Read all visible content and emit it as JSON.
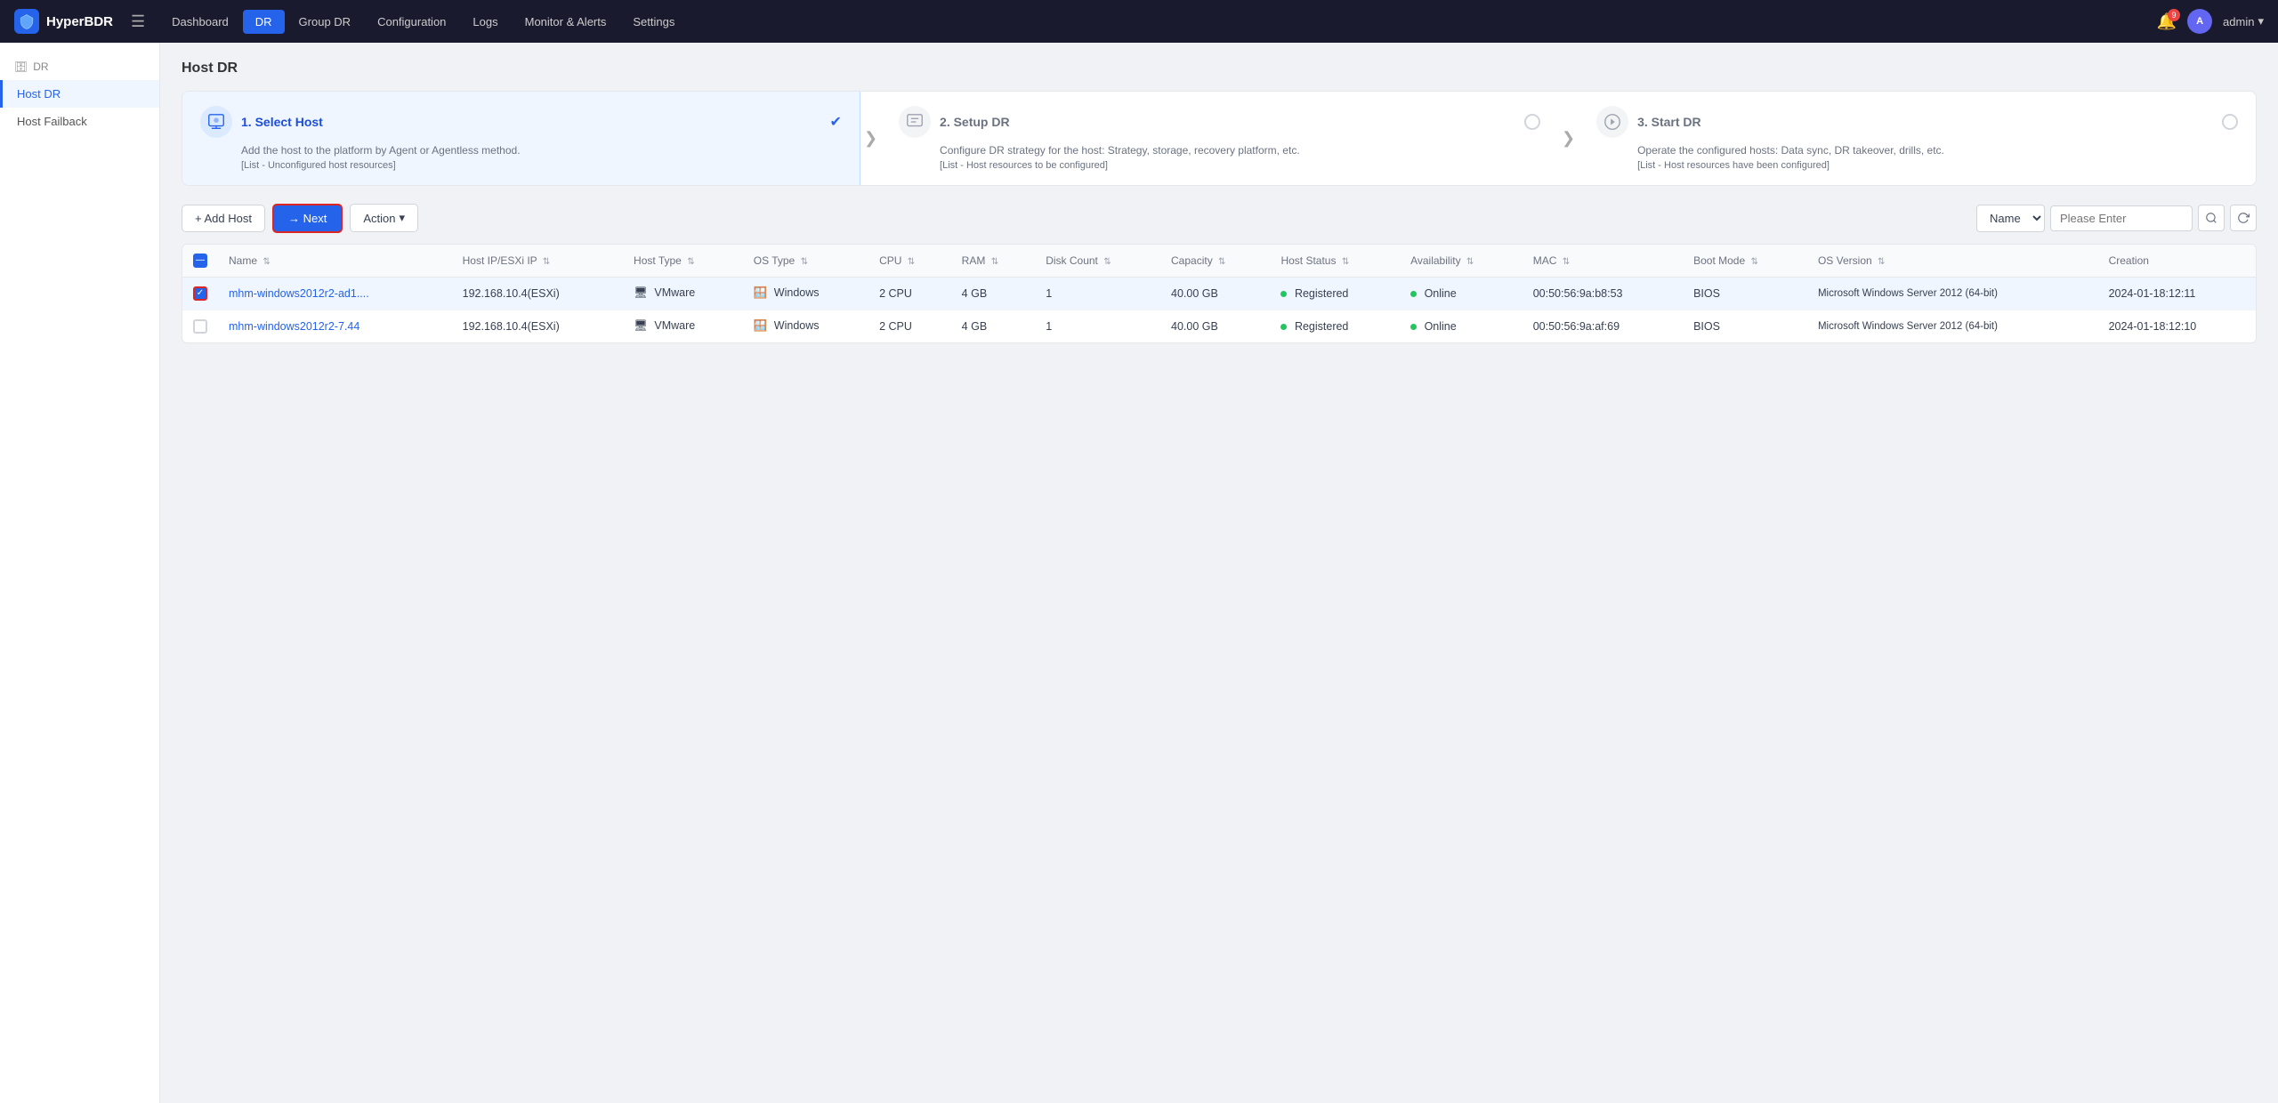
{
  "app": {
    "logo_text": "HyperBDR",
    "bell_count": "9"
  },
  "nav": {
    "items": [
      {
        "label": "Dashboard",
        "active": false
      },
      {
        "label": "DR",
        "active": true
      },
      {
        "label": "Group DR",
        "active": false
      },
      {
        "label": "Configuration",
        "active": false
      },
      {
        "label": "Logs",
        "active": false
      },
      {
        "label": "Monitor & Alerts",
        "active": false
      },
      {
        "label": "Settings",
        "active": false
      }
    ],
    "user_label": "admin",
    "user_initial": "A"
  },
  "sidebar": {
    "parent_label": "DR",
    "items": [
      {
        "label": "Host DR",
        "active": true
      },
      {
        "label": "Host Failback",
        "active": false
      }
    ]
  },
  "page": {
    "title": "Host DR"
  },
  "steps": [
    {
      "number": "1",
      "title": "1. Select Host",
      "desc": "Add the host to the platform by Agent or Agentless method.",
      "link": "[List - Unconfigured host resources]",
      "active": true,
      "checked": true
    },
    {
      "number": "2",
      "title": "2. Setup DR",
      "desc": "Configure DR strategy for the host: Strategy, storage, recovery platform, etc.",
      "link": "[List - Host resources to be configured]",
      "active": false,
      "checked": false
    },
    {
      "number": "3",
      "title": "3. Start DR",
      "desc": "Operate the configured hosts: Data sync, DR takeover, drills, etc.",
      "link": "[List - Host resources have been configured]",
      "active": false,
      "checked": false
    }
  ],
  "toolbar": {
    "add_host_label": "+ Add Host",
    "next_label": "→ Next",
    "action_label": "Action",
    "action_chevron": "▾",
    "filter_name_label": "Name",
    "filter_placeholder": "Please Enter",
    "search_title": "Search",
    "refresh_title": "Refresh"
  },
  "table": {
    "columns": [
      {
        "key": "checkbox",
        "label": ""
      },
      {
        "key": "name",
        "label": "Name"
      },
      {
        "key": "host_ip",
        "label": "Host IP/ESXi IP"
      },
      {
        "key": "host_type",
        "label": "Host Type"
      },
      {
        "key": "os_type",
        "label": "OS Type"
      },
      {
        "key": "cpu",
        "label": "CPU"
      },
      {
        "key": "ram",
        "label": "RAM"
      },
      {
        "key": "disk_count",
        "label": "Disk Count"
      },
      {
        "key": "capacity",
        "label": "Capacity"
      },
      {
        "key": "host_status",
        "label": "Host Status"
      },
      {
        "key": "availability",
        "label": "Availability"
      },
      {
        "key": "mac",
        "label": "MAC"
      },
      {
        "key": "boot_mode",
        "label": "Boot Mode"
      },
      {
        "key": "os_version",
        "label": "OS Version"
      },
      {
        "key": "creation",
        "label": "Creation"
      }
    ],
    "rows": [
      {
        "id": 1,
        "selected": true,
        "name": "mhm-windows2012r2-ad1....",
        "host_ip": "192.168.10.4(ESXi)",
        "host_type": "VMware",
        "os_type": "Windows",
        "cpu": "2 CPU",
        "ram": "4 GB",
        "disk_count": "1",
        "capacity": "40.00 GB",
        "host_status": "Registered",
        "host_status_color": "green",
        "availability": "Online",
        "availability_color": "green",
        "mac": "00:50:56:9a:b8:53",
        "boot_mode": "BIOS",
        "os_version": "Microsoft Windows Server 2012 (64-bit)",
        "creation": "2024-01-18:12:11"
      },
      {
        "id": 2,
        "selected": false,
        "name": "mhm-windows2012r2-7.44",
        "host_ip": "192.168.10.4(ESXi)",
        "host_type": "VMware",
        "os_type": "Windows",
        "cpu": "2 CPU",
        "ram": "4 GB",
        "disk_count": "1",
        "capacity": "40.00 GB",
        "host_status": "Registered",
        "host_status_color": "green",
        "availability": "Online",
        "availability_color": "green",
        "mac": "00:50:56:9a:af:69",
        "boot_mode": "BIOS",
        "os_version": "Microsoft Windows Server 2012 (64-bit)",
        "creation": "2024-01-18:12:10"
      }
    ]
  }
}
